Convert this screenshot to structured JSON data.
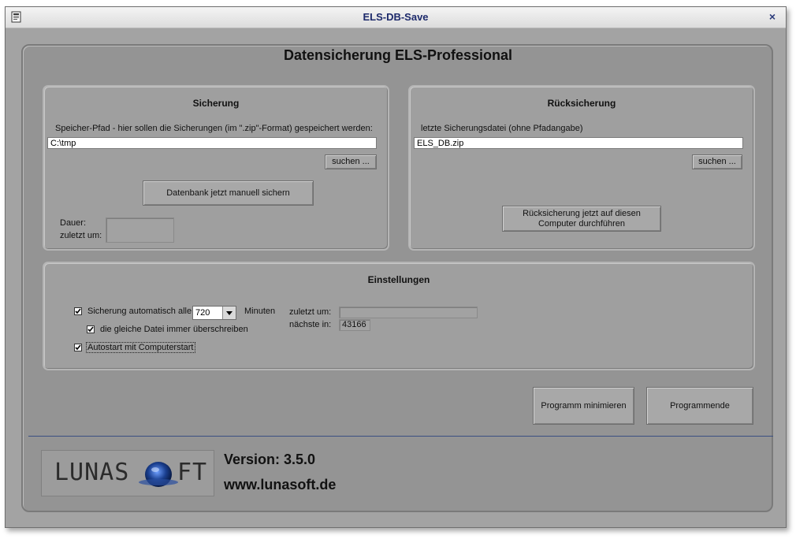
{
  "window": {
    "title": "ELS-DB-Save",
    "close_label": "×"
  },
  "main": {
    "heading": "Datensicherung ELS-Professional"
  },
  "backup": {
    "title": "Sicherung",
    "path_label": "Speicher-Pfad - hier sollen die Sicherungen (im \".zip\"-Format) gespeichert werden:",
    "path_value": "C:\\tmp",
    "browse_label": "suchen ...",
    "manual_button": "Datenbank jetzt manuell sichern",
    "duration_label": "Dauer:",
    "last_label": "zuletzt um:"
  },
  "restore": {
    "title": "Rücksicherung",
    "file_label": "letzte Sicherungsdatei (ohne Pfadangabe)",
    "file_value": "ELS_DB.zip",
    "browse_label": "suchen ...",
    "restore_button_line1": "Rücksicherung jetzt auf diesen",
    "restore_button_line2": "Computer durchführen"
  },
  "settings": {
    "title": "Einstellungen",
    "auto_backup_label": "Sicherung automatisch alle",
    "auto_backup_checked": true,
    "interval_value": "720",
    "minutes_label": "Minuten",
    "overwrite_label": "die gleiche Datei immer überschreiben",
    "overwrite_checked": true,
    "autostart_label": "Autostart mit Computerstart",
    "autostart_checked": true,
    "last_at_label": "zuletzt um:",
    "next_in_label": "nächste in:",
    "next_in_value": "43166"
  },
  "buttons": {
    "minimize_label": "Programm minimieren",
    "exit_label": "Programmende"
  },
  "footer": {
    "logo_text_left": "LUNAS",
    "logo_text_right": "FT",
    "version": "Version: 3.5.0",
    "website": "www.lunasoft.de"
  },
  "colors": {
    "title_text": "#1d2a6b",
    "window_bg": "#a3a3a3",
    "panel_bg": "#9f9f9f",
    "separator": "#3a4f82",
    "logo_globe": "#1a3f8f"
  }
}
